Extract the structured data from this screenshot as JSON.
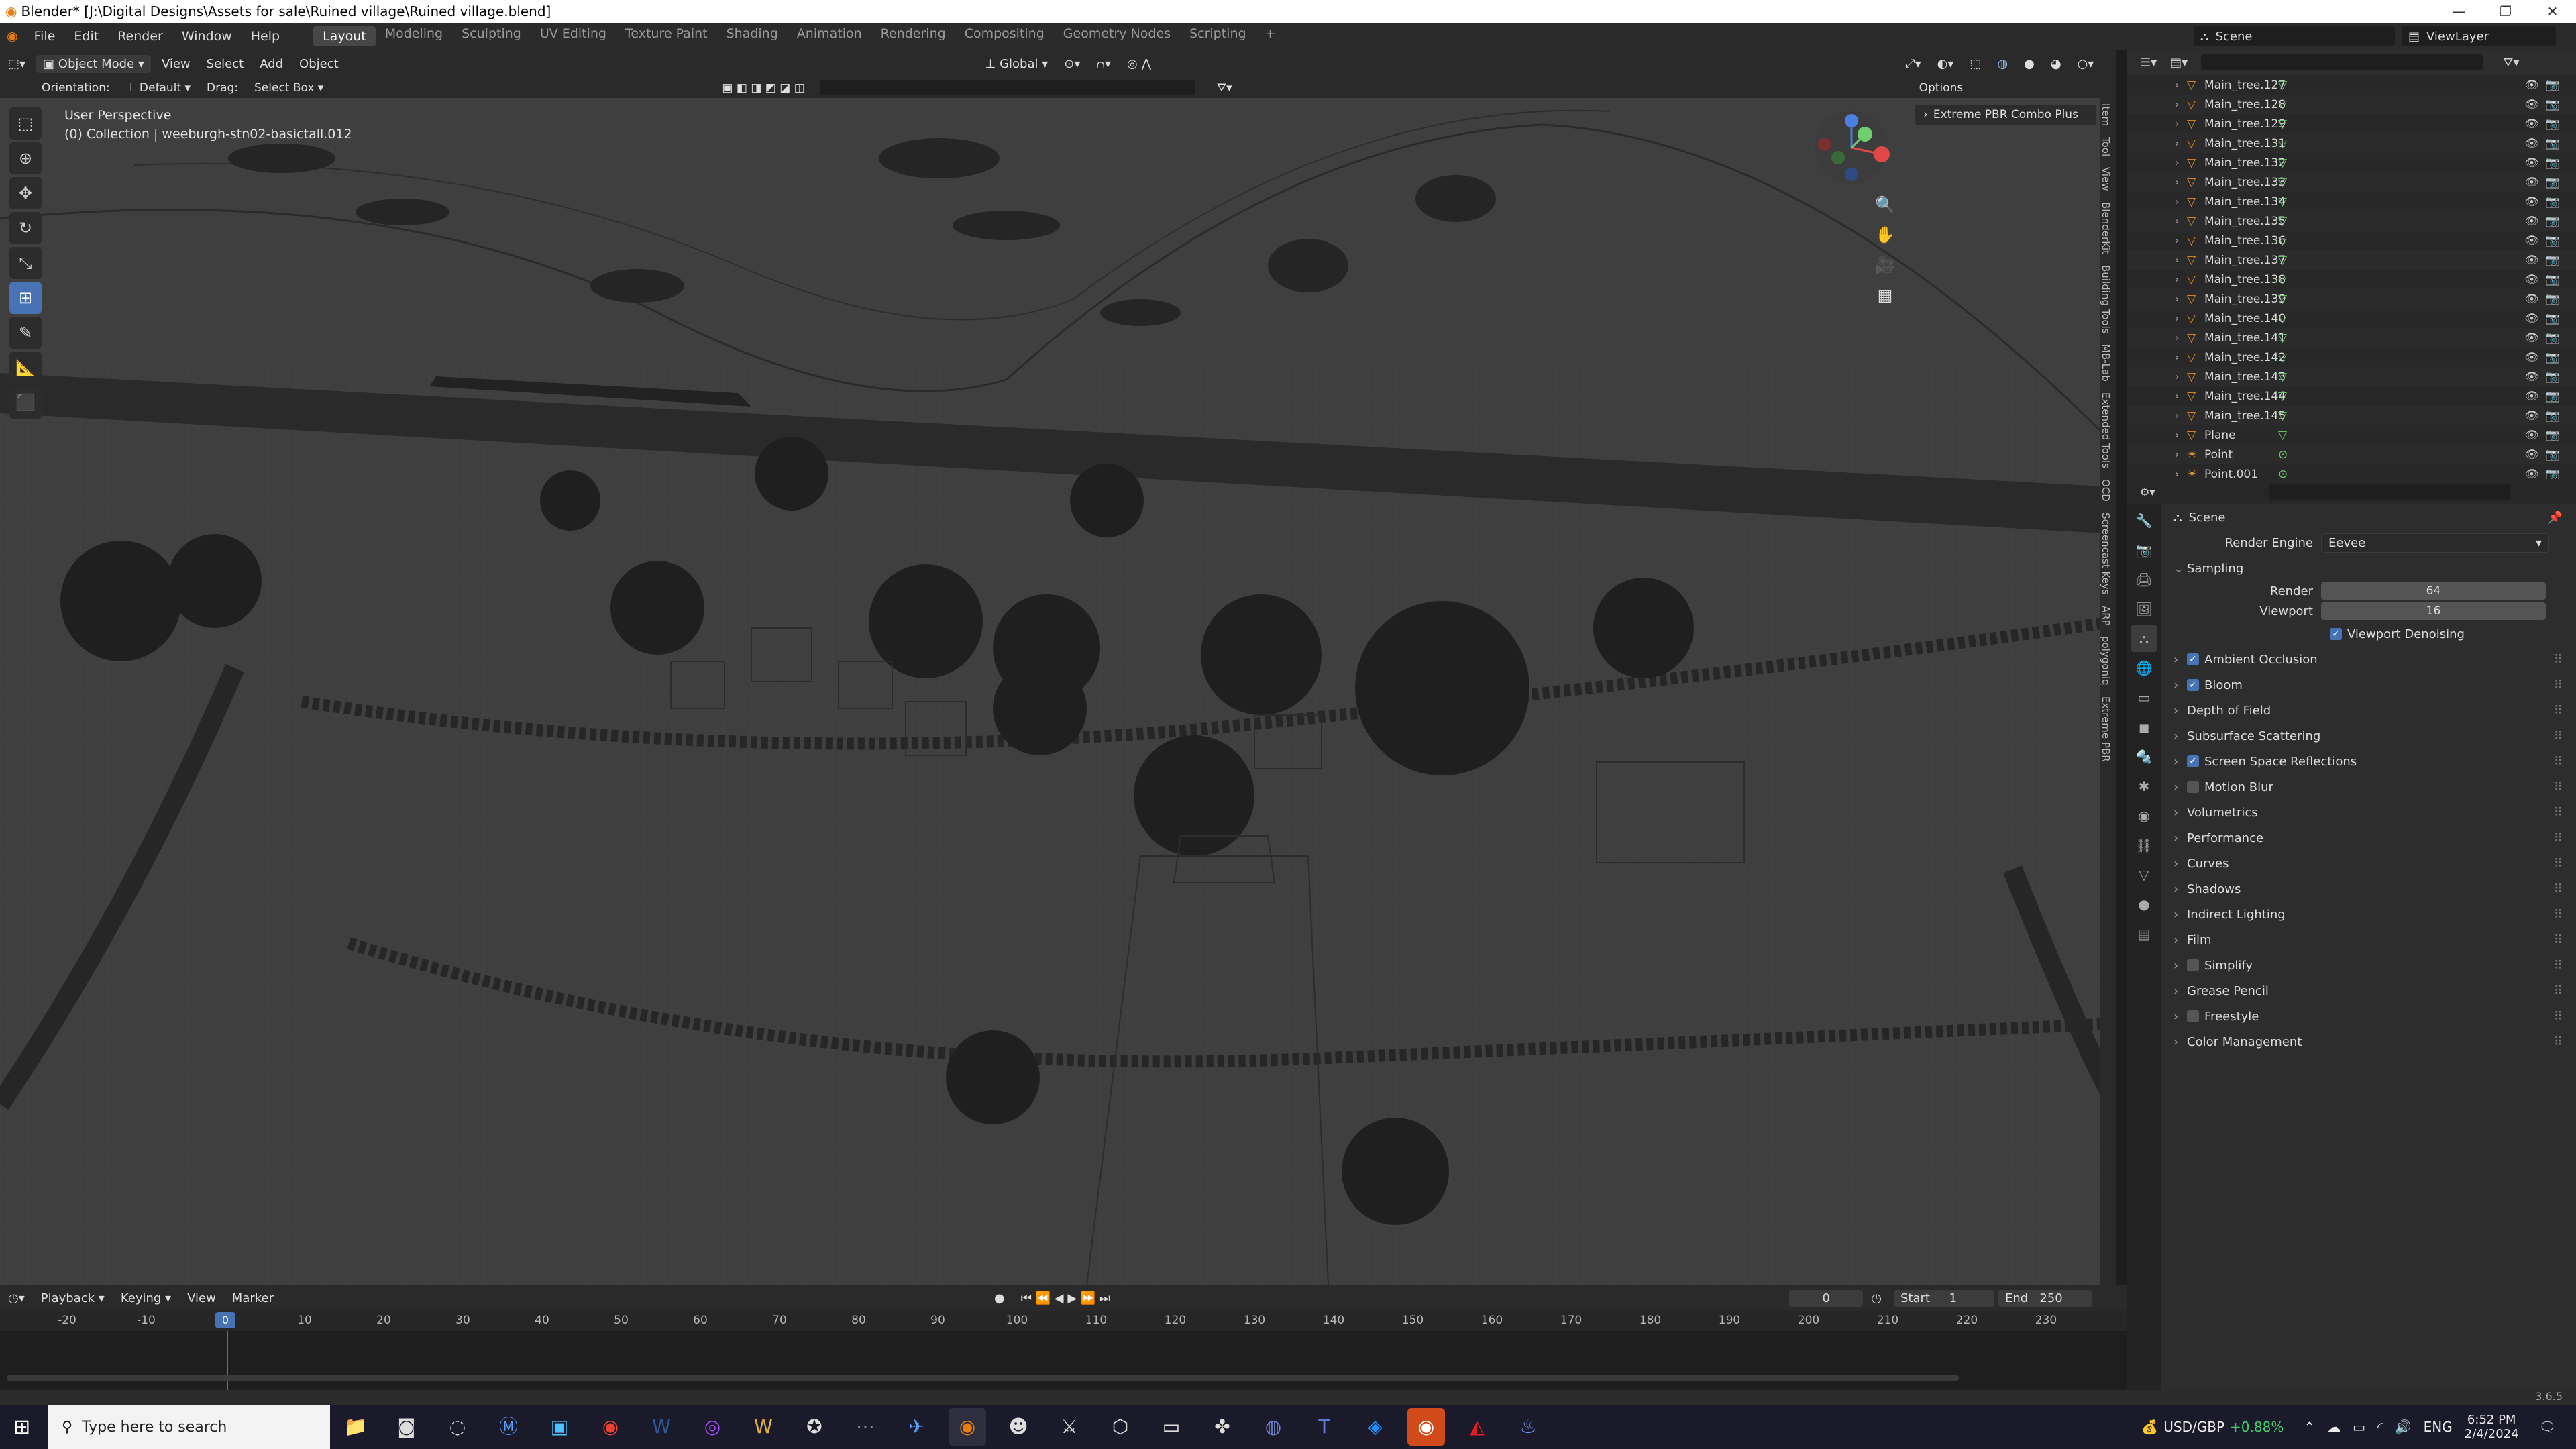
{
  "window": {
    "title": "Blender* [J:\\Digital Designs\\Assets for sale\\Ruined village\\Ruined village.blend]"
  },
  "menu": [
    "File",
    "Edit",
    "Render",
    "Window",
    "Help"
  ],
  "workspaces": [
    "Layout",
    "Modeling",
    "Sculpting",
    "UV Editing",
    "Texture Paint",
    "Shading",
    "Animation",
    "Rendering",
    "Compositing",
    "Geometry Nodes",
    "Scripting",
    "+"
  ],
  "active_workspace": "Layout",
  "scene": {
    "name": "Scene",
    "view_layer": "ViewLayer"
  },
  "viewport_header": {
    "mode": "Object Mode",
    "menus": [
      "View",
      "Select",
      "Add",
      "Object"
    ],
    "transform": "Global",
    "options": "Options"
  },
  "tool_header": {
    "orientation_label": "Orientation:",
    "orientation_value": "Default",
    "drag_label": "Drag:",
    "drag_value": "Select Box"
  },
  "viewport": {
    "perspective": "User Perspective",
    "collection_info": "(0) Collection | weeburgh-stn02-basictall.012",
    "npanel_addon": "Extreme PBR Combo Plus",
    "npanel_tabs": [
      "Item",
      "Tool",
      "View",
      "BlenderKit",
      "Building Tools",
      "MB-Lab",
      "Extended Tools",
      "OCD",
      "Screencast Keys",
      "ARP",
      "polygoniq",
      "Extreme PBR"
    ]
  },
  "toolbar_tools": [
    "select-box",
    "cursor",
    "move",
    "rotate",
    "scale",
    "transform",
    "annotate",
    "measure",
    "add-cube"
  ],
  "timeline": {
    "menus": [
      "Playback",
      "Keying",
      "View",
      "Marker"
    ],
    "current_frame": "0",
    "start_label": "Start",
    "start": "1",
    "end_label": "End",
    "end": "250",
    "ticks": [
      "-20",
      "-10",
      "0",
      "10",
      "20",
      "30",
      "40",
      "50",
      "60",
      "70",
      "80",
      "90",
      "100",
      "110",
      "120",
      "130",
      "140",
      "150",
      "160",
      "170",
      "180",
      "190",
      "200",
      "210",
      "220",
      "230"
    ]
  },
  "outliner": {
    "items": [
      "Main_tree.127",
      "Main_tree.128",
      "Main_tree.129",
      "Main_tree.131",
      "Main_tree.132",
      "Main_tree.133",
      "Main_tree.134",
      "Main_tree.135",
      "Main_tree.136",
      "Main_tree.137",
      "Main_tree.138",
      "Main_tree.139",
      "Main_tree.140",
      "Main_tree.141",
      "Main_tree.142",
      "Main_tree.143",
      "Main_tree.144",
      "Main_tree.145",
      "Plane",
      "Point",
      "Point.001"
    ]
  },
  "properties": {
    "context": "Scene",
    "render_engine_label": "Render Engine",
    "render_engine": "Eevee",
    "sampling_label": "Sampling",
    "render_label": "Render",
    "render_samples": "64",
    "viewport_label": "Viewport",
    "viewport_samples": "16",
    "viewport_denoising": "Viewport Denoising",
    "sections": [
      {
        "label": "Ambient Occlusion",
        "checkbox": true,
        "checked": true
      },
      {
        "label": "Bloom",
        "checkbox": true,
        "checked": true
      },
      {
        "label": "Depth of Field",
        "checkbox": false
      },
      {
        "label": "Subsurface Scattering",
        "checkbox": false
      },
      {
        "label": "Screen Space Reflections",
        "checkbox": true,
        "checked": true
      },
      {
        "label": "Motion Blur",
        "checkbox": true,
        "checked": false
      },
      {
        "label": "Volumetrics",
        "checkbox": false
      },
      {
        "label": "Performance",
        "checkbox": false
      },
      {
        "label": "Curves",
        "checkbox": false
      },
      {
        "label": "Shadows",
        "checkbox": false
      },
      {
        "label": "Indirect Lighting",
        "checkbox": false
      },
      {
        "label": "Film",
        "checkbox": false
      },
      {
        "label": "Simplify",
        "checkbox": true,
        "checked": false
      },
      {
        "label": "Grease Pencil",
        "checkbox": false
      },
      {
        "label": "Freestyle",
        "checkbox": true,
        "checked": false
      },
      {
        "label": "Color Management",
        "checkbox": false
      }
    ]
  },
  "version": "3.6.5",
  "taskbar": {
    "search_placeholder": "Type here to search",
    "ticker": "USD/GBP",
    "ticker_change": "+0.88%",
    "lang": "ENG",
    "time": "6:52 PM",
    "date": "2/4/2024"
  },
  "colors": {
    "accent": "#4772b3",
    "object_orange": "#e0902c",
    "mesh_green": "#6fcf70"
  }
}
